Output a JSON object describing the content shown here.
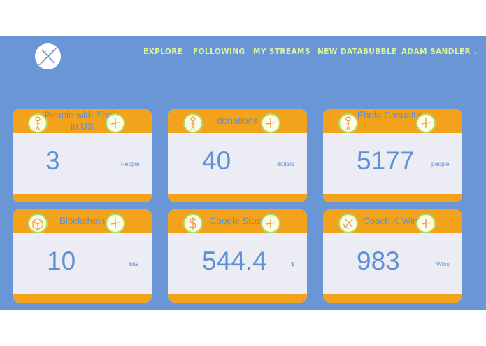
{
  "logo": {
    "icon": "dna-logo-icon"
  },
  "nav": {
    "explore": "EXPLORE",
    "following": "FOLLOWING",
    "my_streams": "MY STREAMS",
    "new_databubble": "NEW DATABUBBLE",
    "user": "ADAM SANDLER",
    "user_chevron": "⌄"
  },
  "colors": {
    "background": "#6b96d6",
    "card_accent": "#f3a31b",
    "card_body": "#ecedf4",
    "nav_text": "#d8f59a",
    "value_text": "#5f8fd4"
  },
  "cards": [
    {
      "title": "People with Ebola in US",
      "value": "3",
      "unit": "People",
      "icon": "person-icon",
      "action_icon": "plus-icon"
    },
    {
      "title": "donations",
      "value": "40",
      "unit": "dollars",
      "icon": "person-icon",
      "action_icon": "plus-icon"
    },
    {
      "title": "Ebola Casualties",
      "value": "5177",
      "unit": "people",
      "icon": "person-icon",
      "action_icon": "plus-icon"
    },
    {
      "title": "Blockchain",
      "value": "10",
      "unit": "bits",
      "icon": "cube-icon",
      "action_icon": "plus-icon"
    },
    {
      "title": "Google Stock",
      "value": "544.4",
      "unit": "$",
      "icon": "dollar-icon",
      "action_icon": "plus-icon"
    },
    {
      "title": "Coach K Wins",
      "value": "983",
      "unit": "Wins",
      "icon": "basketball-icon",
      "action_icon": "plus-icon"
    }
  ]
}
